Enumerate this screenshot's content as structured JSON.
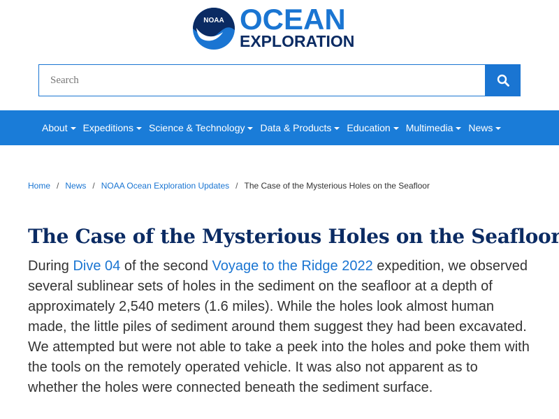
{
  "logo": {
    "badge_text": "NOAA",
    "word1": "OCEAN",
    "word2": "EXPLORATION"
  },
  "search": {
    "placeholder": "Search"
  },
  "nav": {
    "items": [
      "About",
      "Expeditions",
      "Science & Technology",
      "Data & Products",
      "Education",
      "Multimedia",
      "News"
    ]
  },
  "breadcrumb": {
    "home": "Home",
    "news": "News",
    "updates": "NOAA Ocean Exploration Updates",
    "current": "The Case of the Mysterious Holes on the Seafloor"
  },
  "article": {
    "title": "The Case of the Mysterious Holes on the Seafloor",
    "p_during": "During ",
    "link_dive": "Dive 04",
    "p_mid": " of the second ",
    "link_voyage": "Voyage to the Ridge 2022",
    "p_rest": " expedition, we observed several sublinear sets of holes in the sediment on the seafloor at a depth of approximately 2,540 meters (1.6 miles). While the holes look almost human made, the little piles of sediment around them suggest they had been excavated. We attempted but were not able to take a peek into the holes and poke them with the tools on the remotely operated vehicle. It was also not apparent as to whether the holes were connected beneath the sediment surface."
  },
  "colors": {
    "brand_blue": "#1a75d2",
    "nav_blue": "#1a7cd8",
    "navy": "#0b2b63"
  }
}
